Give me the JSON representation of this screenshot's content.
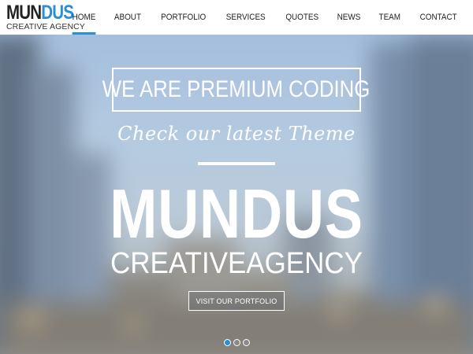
{
  "logo": {
    "name_part1": "MUN",
    "name_part2": "DUS",
    "tagline": "CREATIVE AGENCY"
  },
  "nav": {
    "items": [
      {
        "label": "HOME",
        "active": true
      },
      {
        "label": "ABOUT",
        "active": false
      },
      {
        "label": "PORTFOLIO",
        "active": false
      },
      {
        "label": "SERVICES",
        "active": false
      },
      {
        "label": "QUOTES",
        "active": false
      },
      {
        "label": "NEWS",
        "active": false
      },
      {
        "label": "TEAM",
        "active": false
      },
      {
        "label": "CONTACT",
        "active": false
      }
    ]
  },
  "hero": {
    "heading": "WE ARE PREMIUM CODING",
    "script_text": "Check our latest Theme",
    "brand_title": "MUNDUS",
    "brand_subtitle": "CREATIVEAGENCY",
    "cta_label": "VISIT OUR PORTFOLIO"
  },
  "slider": {
    "slide_count": 3,
    "active_index": 0
  },
  "colors": {
    "accent": "#2a8ed6",
    "header_bg": "#ffffff",
    "hero_text": "#ffffff"
  }
}
